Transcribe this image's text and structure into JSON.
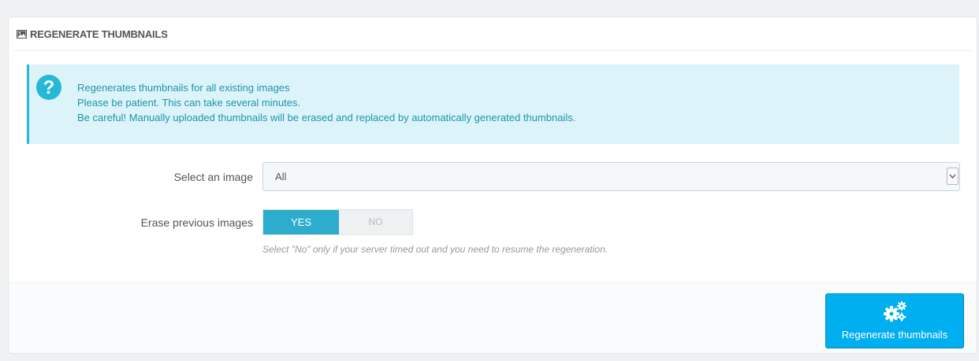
{
  "panel": {
    "title": "REGENERATE THUMBNAILS",
    "icon": "picture-icon"
  },
  "alert": {
    "icon": "question-circle-icon",
    "lines": [
      "Regenerates thumbnails for all existing images",
      "Please be patient. This can take several minutes.",
      "Be careful! Manually uploaded thumbnails will be erased and replaced by automatically generated thumbnails."
    ]
  },
  "form": {
    "select_label": "Select an image",
    "select_value": "All",
    "erase_label": "Erase previous images",
    "erase_yes": "YES",
    "erase_no": "NO",
    "erase_selected": "YES",
    "erase_help": "Select \"No\" only if your server timed out and you need to resume the regeneration."
  },
  "footer": {
    "button_label": "Regenerate thumbnails",
    "button_icon": "cogs-icon"
  },
  "colors": {
    "accent": "#25b9d7",
    "toggle_active": "#2eacce",
    "button": "#00aff0",
    "alert_bg": "#dcf4f9",
    "alert_text": "#1e94ab"
  }
}
